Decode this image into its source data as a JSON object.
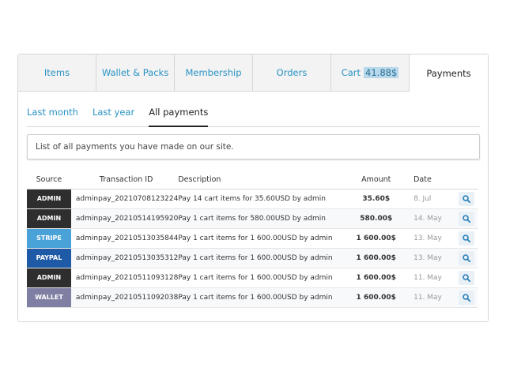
{
  "main_tabs": [
    {
      "label": "Items"
    },
    {
      "label": "Wallet & Packs"
    },
    {
      "label": "Membership"
    },
    {
      "label": "Orders"
    },
    {
      "label": "Cart",
      "amount": "41.88$"
    },
    {
      "label": "Payments"
    }
  ],
  "sub_tabs": [
    {
      "label": "Last month"
    },
    {
      "label": "Last year"
    },
    {
      "label": "All payments"
    }
  ],
  "info_text": "List of all payments you have made on our site.",
  "table": {
    "headers": {
      "source": "Source",
      "transaction_id": "Transaction ID",
      "description": "Description",
      "amount": "Amount",
      "date": "Date"
    },
    "rows": [
      {
        "source": "ADMIN",
        "source_color": "#2e2e2e",
        "transaction_id": "adminpay_20210708123224",
        "description": "Pay 14 cart items for 35.60USD by admin",
        "amount": "35.60$",
        "date": "8. Jul"
      },
      {
        "source": "ADMIN",
        "source_color": "#2e2e2e",
        "transaction_id": "adminpay_20210514195920",
        "description": "Pay 1 cart items for 580.00USD by admin",
        "amount": "580.00$",
        "date": "14. May"
      },
      {
        "source": "STRIPE",
        "source_color": "#4aa3d8",
        "transaction_id": "adminpay_20210513035844",
        "description": "Pay 1 cart items for 1 600.00USD by admin",
        "amount": "1 600.00$",
        "date": "13. May"
      },
      {
        "source": "PAYPAL",
        "source_color": "#1f5aa6",
        "transaction_id": "adminpay_20210513035312",
        "description": "Pay 1 cart items for 1 600.00USD by admin",
        "amount": "1 600.00$",
        "date": "13. May"
      },
      {
        "source": "ADMIN",
        "source_color": "#2e2e2e",
        "transaction_id": "adminpay_20210511093128",
        "description": "Pay 1 cart items for 1 600.00USD by admin",
        "amount": "1 600.00$",
        "date": "11. May"
      },
      {
        "source": "WALLET",
        "source_color": "#7f7fa3",
        "transaction_id": "adminpay_20210511092038",
        "description": "Pay 1 cart items for 1 600.00USD by admin",
        "amount": "1 600.00$",
        "date": "11. May"
      }
    ],
    "action_icon": "magnifier-icon"
  },
  "colors": {
    "link": "#2a92c4",
    "cart_highlight": "#b8d9ec",
    "tab_bar": "#f3f3f3"
  }
}
